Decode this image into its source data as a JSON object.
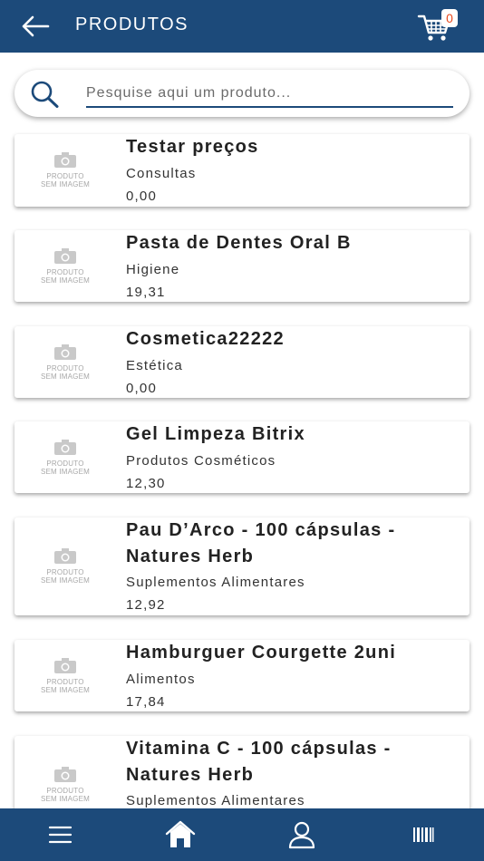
{
  "header": {
    "title": "PRODUTOS",
    "cart_count": "0",
    "back_icon": "arrow-left-icon",
    "cart_icon": "shopping-cart-icon"
  },
  "search": {
    "placeholder": "Pesquise aqui um produto...",
    "value": ""
  },
  "placeholder_image": {
    "line1": "PRODUTO",
    "line2": "SEM IMAGEM"
  },
  "products": [
    {
      "name": "Testar preços",
      "category": "Consultas",
      "price": "0,00"
    },
    {
      "name": "Pasta de Dentes Oral B",
      "category": "Higiene",
      "price": "19,31"
    },
    {
      "name": "Cosmetica22222",
      "category": "Estética",
      "price": "0,00"
    },
    {
      "name": "Gel Limpeza Bitrix",
      "category": "Produtos Cosméticos",
      "price": "12,30"
    },
    {
      "name": "Pau D’Arco - 100 cápsulas - Natures Herb",
      "category": "Suplementos Alimentares",
      "price": "12,92"
    },
    {
      "name": "Hamburguer Courgette 2uni",
      "category": "Alimentos",
      "price": "17,84"
    },
    {
      "name": "Vitamina C - 100 cápsulas - Natures Herb",
      "category": "Suplementos Alimentares",
      "price": ""
    }
  ],
  "bottom_nav": [
    {
      "icon": "menu-icon"
    },
    {
      "icon": "home-icon"
    },
    {
      "icon": "user-icon"
    },
    {
      "icon": "barcode-icon"
    }
  ],
  "colors": {
    "primary": "#1c4a7a",
    "badge_text": "#e8491d"
  }
}
